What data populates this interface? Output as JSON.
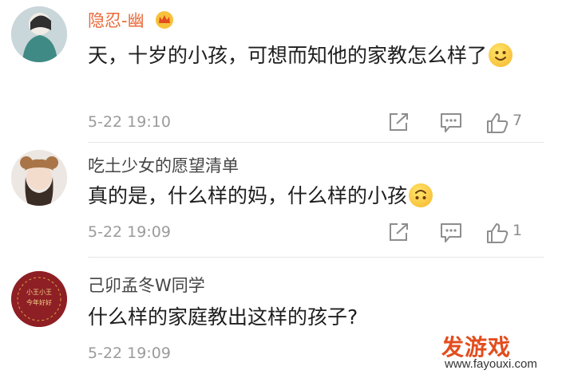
{
  "comments": [
    {
      "username": "隐忍-幽",
      "text": "天，十岁的小孩，可想而知他的家教怎么样了",
      "time": "5-22 19:10",
      "likes": "7",
      "vip": true
    },
    {
      "username": "吃土少女的愿望清单",
      "text": "真的是，什么样的妈，什么样的小孩",
      "time": "5-22 19:09",
      "likes": "1"
    },
    {
      "username": "己卯孟冬W同学",
      "text": "什么样的家庭教出这样的孩子?",
      "time": "5-22 19:09",
      "avatar_text": "小王小王 今年好好"
    }
  ],
  "watermark": {
    "title": "发游戏",
    "url": "www.fayouxi.com"
  },
  "colors": {
    "vip_name": "#e8693a",
    "meta_gray": "#9b9b9b",
    "emoji_yellow": "#f6c22a",
    "watermark_orange": "#e34d1e"
  }
}
